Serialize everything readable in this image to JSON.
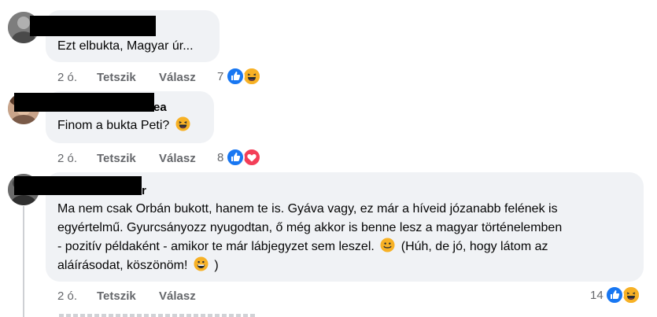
{
  "comments": [
    {
      "name_visible": "",
      "text": "Ezt elbukta, Magyar úr...",
      "time": "2 ó.",
      "like": "Tetszik",
      "reply": "Válasz",
      "reaction_count": "7",
      "reactions": [
        "like-icon",
        "haha-icon"
      ]
    },
    {
      "name_visible": "ea",
      "text": "Finom a bukta Peti?",
      "time": "2 ó.",
      "like": "Tetszik",
      "reply": "Válasz",
      "reaction_count": "8",
      "reactions": [
        "like-icon",
        "love-icon"
      ]
    },
    {
      "name_visible": "r",
      "text_lines": [
        "Ma nem csak Orbán bukott, hanem te is. Gyáva vagy, ez már a híveid józanabb felének is",
        "egyértelmű. Gyurcsányozz nyugodtan, ő még akkor is benne lesz a magyar történelemben",
        "- pozitív példaként - amikor te már lábjegyzet sem leszel.",
        "(Húh, de jó, hogy látom az",
        "aláírásodat, köszönöm!",
        ")"
      ],
      "time": "2 ó.",
      "like": "Tetszik",
      "reply": "Válasz",
      "reaction_count": "14",
      "reactions": [
        "like-icon",
        "haha-icon"
      ]
    }
  ],
  "colors": {
    "bubble": "#f0f2f5",
    "like_blue": "#1877f2",
    "love_red": "#f33e58",
    "haha_yellow": "#f7b125",
    "meta_gray": "#65676b"
  }
}
